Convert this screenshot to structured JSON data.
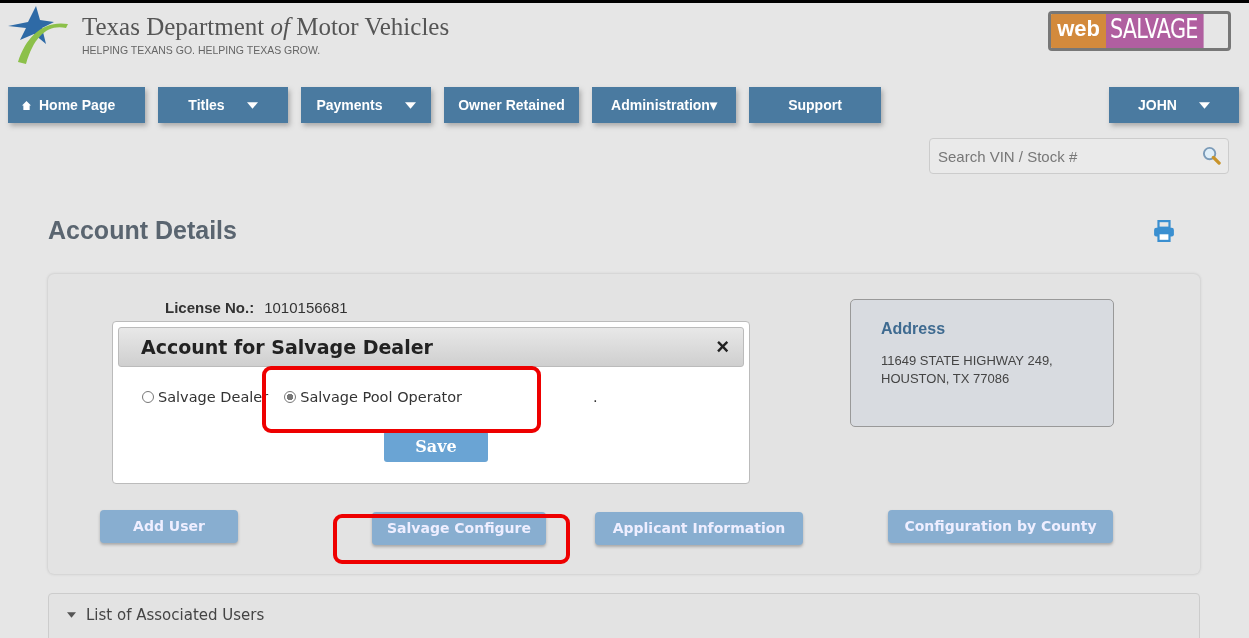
{
  "header": {
    "title": "Texas Department",
    "title_italic": "of",
    "title_end": "Motor Vehicles",
    "tagline": "HELPING TEXANS GO. HELPING TEXAS GROW.",
    "logo_left": "web",
    "logo_right": "SALVAGE"
  },
  "nav": [
    {
      "label": "Home Page",
      "kind": "home"
    },
    {
      "label": "Titles",
      "kind": "dropdown"
    },
    {
      "label": "Payments",
      "kind": "dropdown"
    },
    {
      "label": "Owner Retained",
      "kind": "plain"
    },
    {
      "label": "Administration▾",
      "kind": "plain"
    },
    {
      "label": "Support",
      "kind": "plain"
    }
  ],
  "user_menu": {
    "label": "JOHN"
  },
  "search": {
    "placeholder": "Search VIN / Stock #"
  },
  "page_title": "Account Details",
  "license": {
    "label": "License No.:",
    "value": "1010156681"
  },
  "address": {
    "heading": "Address",
    "lines": [
      "11649 STATE HIGHWAY 249,",
      "HOUSTON, TX 77086"
    ]
  },
  "dialog": {
    "title": "Account for Salvage Dealer",
    "close": "×",
    "options": [
      {
        "label": "Salvage Dealer",
        "selected": false
      },
      {
        "label": "Salvage Pool Operator",
        "selected": true
      }
    ],
    "note": ".",
    "save": "Save"
  },
  "buttons": [
    "Add User",
    "Salvage Configure",
    "Applicant Information",
    "Configuration by County"
  ],
  "section": {
    "label": "List of Associated Users",
    "expanded": true
  }
}
